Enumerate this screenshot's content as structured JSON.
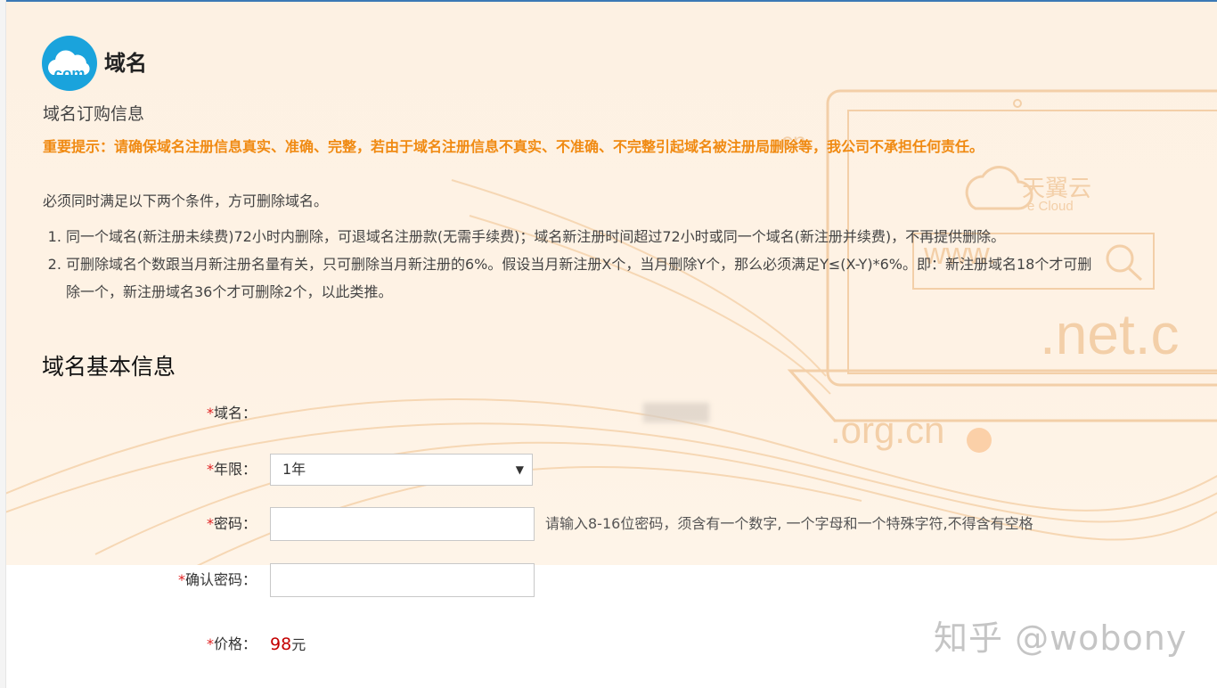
{
  "page": {
    "title": "域名"
  },
  "logo": {
    "text": "com"
  },
  "order_info": {
    "heading": "域名订购信息",
    "notice": "重要提示：请确保域名注册信息真实、准确、完整，若由于域名注册信息不真实、不准确、不完整引起域名被注册局删除等，我公司不承担任何责任。",
    "conditions_intro": "必须同时满足以下两个条件，方可删除域名。",
    "rules": [
      "同一个域名(新注册未续费)72小时内删除，可退域名注册款(无需手续费)；域名新注册时间超过72小时或同一个域名(新注册并续费)，不再提供删除。",
      "可删除域名个数跟当月新注册名量有关，只可删除当月新注册的6%。假设当月新注册X个，当月删除Y个，那么必须满足Y≤(X-Y)*6%。即：新注册域名18个才可删除一个，新注册域名36个才可删除2个，以此类推。"
    ]
  },
  "basic_info": {
    "heading": "域名基本信息",
    "required_mark": "*",
    "domain_label": "域名：",
    "period_label": "年限：",
    "period_value": "1年",
    "password_label": "密码：",
    "password_hint": "请输入8-16位密码，须含有一个数字, 一个字母和一个特殊字符,不得含有空格",
    "confirm_label": "确认密码：",
    "price_label": "价格：",
    "price_value": "98",
    "price_unit": "元"
  },
  "banner_art": {
    "brand_cn": "天翼云",
    "brand_en": "e Cloud",
    "www": "www.",
    "cn": "cn",
    "net": ".net.c",
    "org": ".org.cn"
  },
  "watermark": "知乎 @wobony",
  "colors": {
    "notice": "#f08a12",
    "price": "#c40000",
    "required": "#e02020",
    "logo": "#1aa3dc"
  }
}
